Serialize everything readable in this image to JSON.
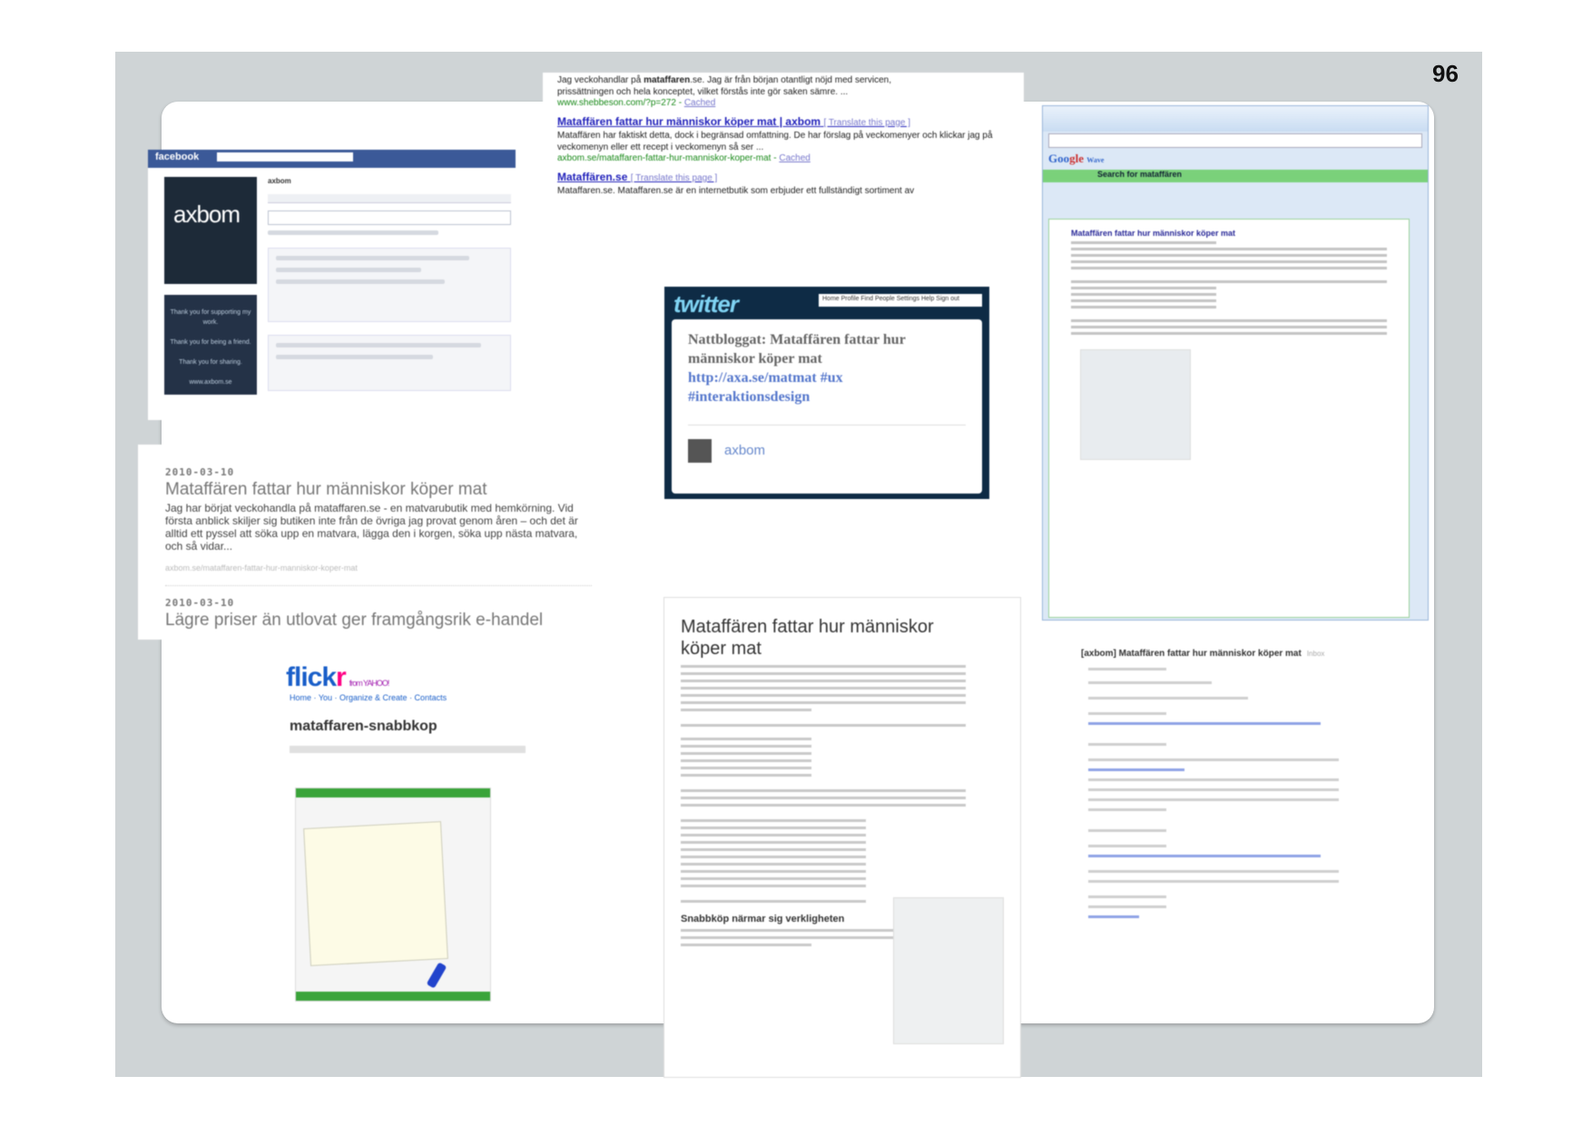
{
  "page": {
    "number": "96"
  },
  "google_results": {
    "snippet_line1_pre": "Jag veckohandlar på ",
    "snippet_line1_bold": "mataffaren",
    "snippet_line1_post": ".se. Jag är från början otantligt nöjd med servicen,",
    "snippet_line2": "prissättningen och hela konceptet, vilket förstås inte gör saken sämre. ...",
    "url1": "www.shebbeson.com/?p=272",
    "cached": "Cached",
    "result2_title": "Mataffären fattar hur människor köper mat | axbom",
    "translate": "[ Translate this page ]",
    "result2_snippet": "Mataffären har faktiskt detta, dock i begränsad omfattning. De har förslag på veckomenyer och klickar jag på veckomenyn eller ett recept i veckomenyn så ser ...",
    "url2": "axbom.se/mataffaren-fattar-hur-manniskor-koper-mat",
    "result3_title": "Mataffären.se",
    "result3_snippet": "Mataffaren.se. Mataffaren.se är en internetbutik som erbjuder ett fullständigt sortiment av"
  },
  "facebook": {
    "brand": "facebook",
    "avatar_logo": "axbom",
    "profile_name": "axbom",
    "sidebar_text": [
      "Thank you for supporting my work.",
      "Thank you for being a friend.",
      "Thank you for sharing.",
      "www.axbom.se"
    ]
  },
  "blog": {
    "post1_date": "2010-03-10",
    "post1_title": "Mataffären fattar hur människor köper mat",
    "post1_excerpt": "Jag har börjat veckohandla på mataffaren.se - en matvarubutik med hemkörning. Vid första anblick skiljer sig butiken inte från de övriga jag provat genom åren – och det är alltid ett pyssel att söka upp en matvara, lägga den i korgen, söka upp nästa matvara, och så vidar...",
    "post1_link": "axbom.se/mataffaren-fattar-hur-manniskor-koper-mat",
    "post2_date": "2010-03-10",
    "post2_title": "Lägre priser än utlovat ger framgångsrik e-handel"
  },
  "twitter": {
    "brand": "twitter",
    "nav": "Home  Profile  Find People  Settings  Help  Sign out",
    "tweet_text": "Nattbloggat: Mataffären fattar hur människor köper mat",
    "tweet_link": "http://axa.se/matmat #ux #interaktionsdesign",
    "username": "axbom"
  },
  "gmail": {
    "brand_blue": "Goo",
    "brand_red": "gle",
    "brand_suffix": "Wave",
    "search_label": "Search for mataffären",
    "subject": "Mataffären fattar hur människor köper mat"
  },
  "flickr": {
    "brand": "flick",
    "brand_r": "r",
    "by": "from YAHOO!",
    "nav": "Home  ·  You  ·  Organize & Create  ·  Contacts",
    "title": "mataffaren-snabbkop"
  },
  "blog_post": {
    "title": "Mataffären fattar hur människor köper mat",
    "subheading": "Snabbköp närmar sig verkligheten"
  },
  "email": {
    "subject": "[axbom] Mataffären fattar hur människor köper mat",
    "tag": "Inbox"
  }
}
